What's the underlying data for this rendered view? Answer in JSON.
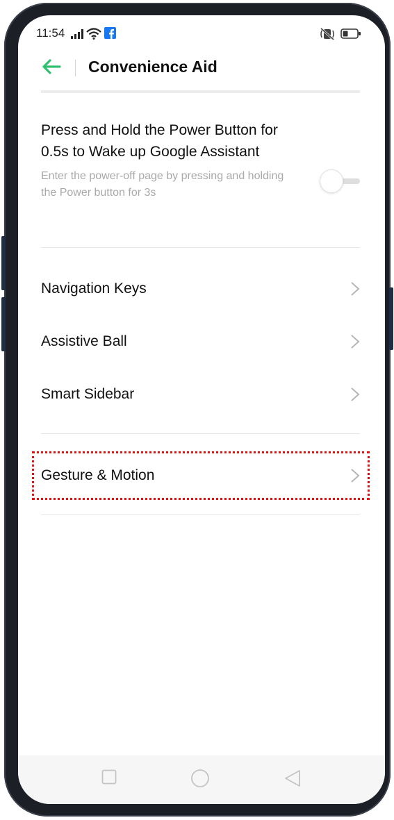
{
  "status_bar": {
    "time": "11:54",
    "icons": [
      "signal-icon",
      "wifi-icon",
      "facebook-icon",
      "mute-vibrate-icon",
      "battery-icon"
    ]
  },
  "header": {
    "title": "Convenience Aid",
    "back_icon": "back-arrow-icon"
  },
  "power_button_setting": {
    "title": "Press and Hold the Power Button for 0.5s to Wake up Google Assistant",
    "description": "Enter the power-off page by pressing and holding the Power button for 3s",
    "enabled": false
  },
  "menu_items": [
    {
      "label": "Navigation Keys"
    },
    {
      "label": "Assistive Ball"
    },
    {
      "label": "Smart Sidebar"
    },
    {
      "label": "Gesture & Motion"
    }
  ],
  "nav_bar": {
    "buttons": [
      "recents-square-icon",
      "home-circle-icon",
      "back-triangle-icon"
    ]
  },
  "colors": {
    "accent": "#2fbf71",
    "highlight": "#e01010",
    "text_primary": "#111111",
    "text_secondary": "#a9a9a9"
  }
}
